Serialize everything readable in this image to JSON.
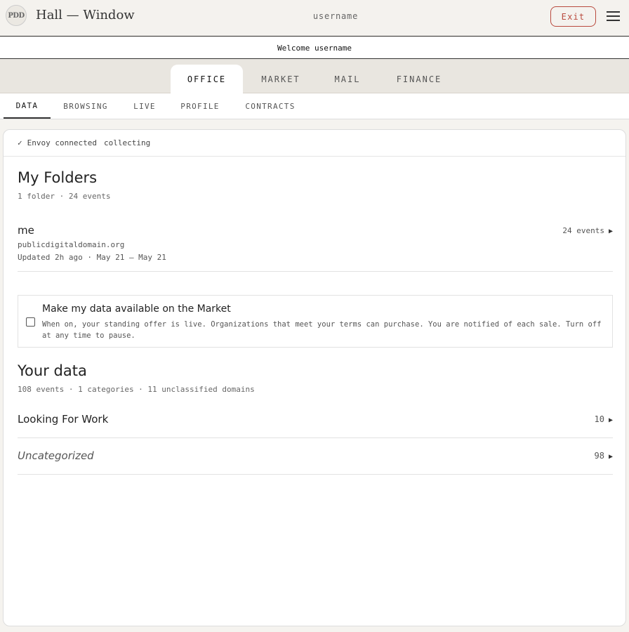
{
  "header": {
    "logo_text": "PDD",
    "title": "Hall — Window",
    "username": "username",
    "exit_label": "Exit"
  },
  "welcome": "Welcome username",
  "main_tabs": [
    {
      "label": "OFFICE",
      "active": true
    },
    {
      "label": "MARKET",
      "active": false
    },
    {
      "label": "MAIL",
      "active": false
    },
    {
      "label": "FINANCE",
      "active": false
    }
  ],
  "sub_tabs": [
    {
      "label": "DATA",
      "active": true
    },
    {
      "label": "BROWSING",
      "active": false
    },
    {
      "label": "LIVE",
      "active": false
    },
    {
      "label": "PROFILE",
      "active": false
    },
    {
      "label": "CONTRACTS",
      "active": false
    }
  ],
  "status": {
    "check": "✓",
    "text": "Envoy connected",
    "state": "collecting"
  },
  "folders": {
    "title": "My Folders",
    "summary": "1 folder · 24 events",
    "items": [
      {
        "name": "me",
        "domain": "publicdigitaldomain.org",
        "updated": "Updated 2h ago · May 21 – May 21",
        "count": "24 events"
      }
    ]
  },
  "market": {
    "title": "Make my data available on the Market",
    "description": "When on, your standing offer is live. Organizations that meet your terms can purchase. You are notified of each sale. Turn off at any time to pause.",
    "checked": false
  },
  "your_data": {
    "title": "Your data",
    "summary": "108 events · 1 categories · 11 unclassified domains",
    "categories": [
      {
        "name": "Looking For Work",
        "count": "10"
      },
      {
        "name": "Uncategorized",
        "count": "98"
      }
    ]
  },
  "icons": {
    "arrow": "▶",
    "menu": "hamburger-menu-icon"
  },
  "colors": {
    "exit_accent": "#b94a3e",
    "background": "#f5f3ef",
    "tab_bar": "#e9e6e0"
  }
}
